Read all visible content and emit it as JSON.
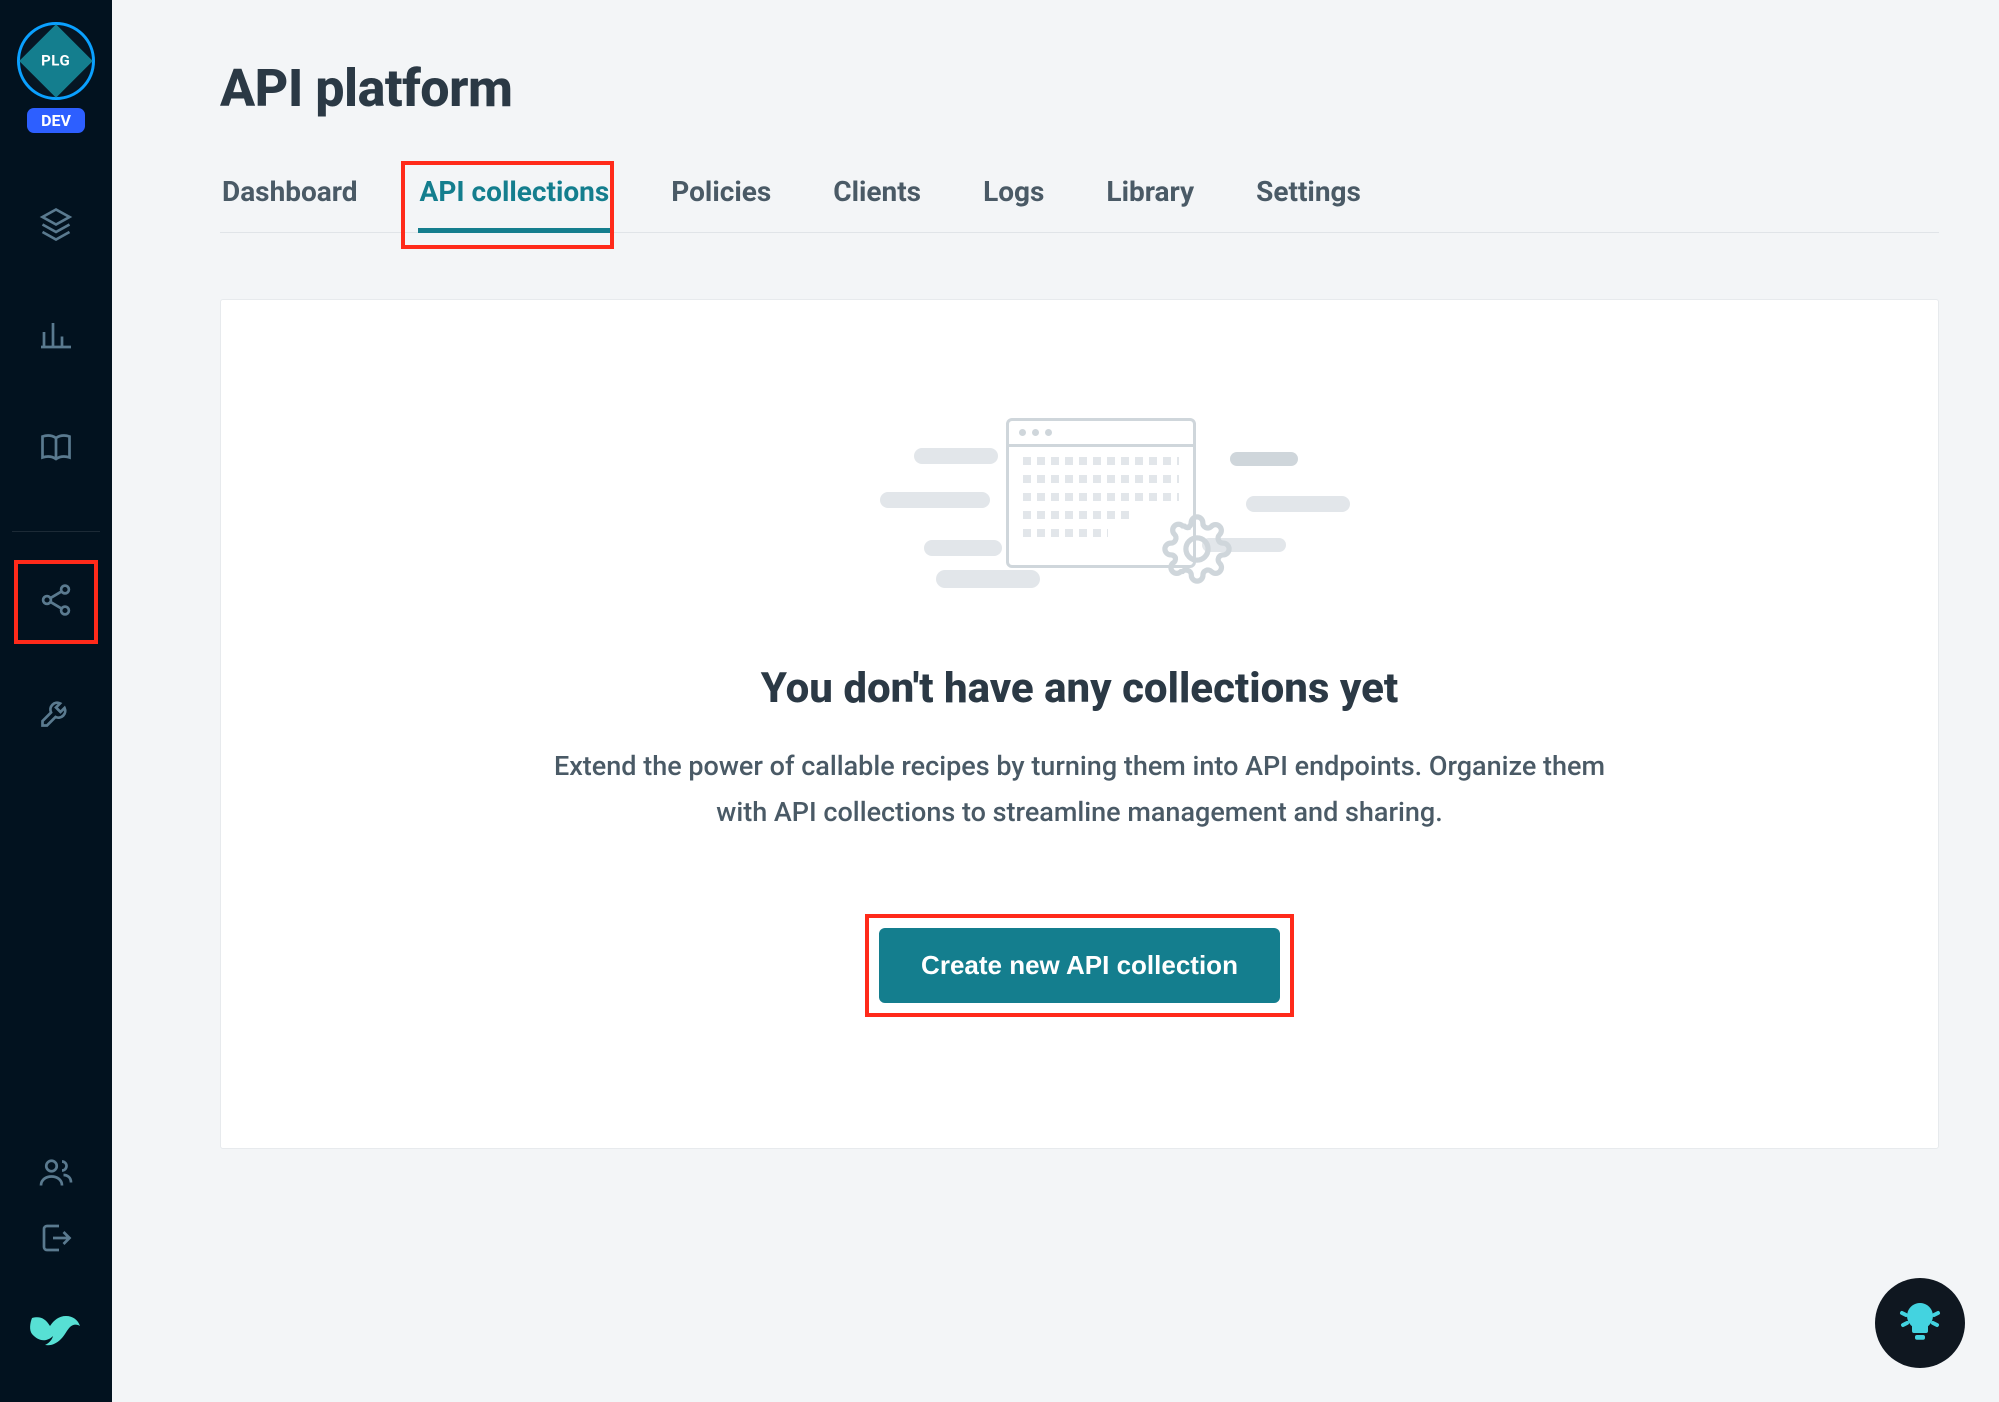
{
  "sidebar": {
    "logo_abbr": "PLG",
    "env_badge": "DEV",
    "items": [
      {
        "name": "layers",
        "active": false
      },
      {
        "name": "analytics",
        "active": false
      },
      {
        "name": "library",
        "active": false
      },
      {
        "name": "api-platform",
        "active": true
      },
      {
        "name": "tools",
        "active": false
      }
    ],
    "footer_items": [
      {
        "name": "team"
      },
      {
        "name": "logout"
      }
    ]
  },
  "page": {
    "title": "API platform"
  },
  "tabs": [
    {
      "label": "Dashboard",
      "active": false
    },
    {
      "label": "API collections",
      "active": true
    },
    {
      "label": "Policies",
      "active": false
    },
    {
      "label": "Clients",
      "active": false
    },
    {
      "label": "Logs",
      "active": false
    },
    {
      "label": "Library",
      "active": false
    },
    {
      "label": "Settings",
      "active": false
    }
  ],
  "empty_state": {
    "heading": "You don't have any collections yet",
    "description": "Extend the power of callable recipes by turning them into API endpoints. Organize them with API collections to streamline management and sharing.",
    "cta_label": "Create new API collection"
  },
  "highlights": {
    "sidebar_item": "api-platform",
    "tab": "API collections",
    "cta": true
  }
}
